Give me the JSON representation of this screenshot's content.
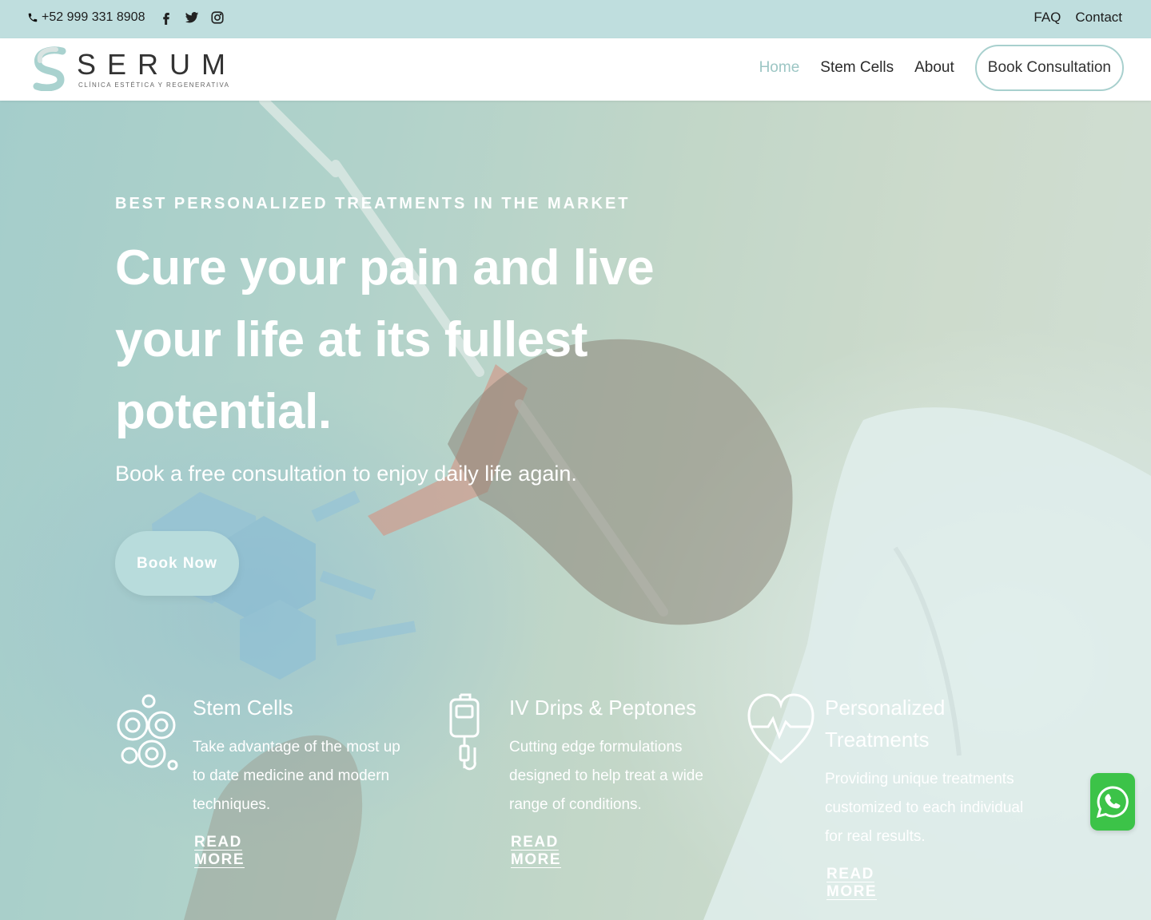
{
  "topbar": {
    "phone": "+52 999 331 8908",
    "socials": [
      "facebook-icon",
      "twitter-icon",
      "instagram-icon"
    ],
    "links": [
      "FAQ",
      "Contact"
    ]
  },
  "header": {
    "logo_word": "SERUM",
    "logo_tagline": "CLÍNICA ESTÉTICA Y REGENERATIVA",
    "nav": {
      "home": "Home",
      "stem_cells": "Stem Cells",
      "about": "About",
      "cta": "Book Consultation"
    }
  },
  "hero": {
    "eyebrow": "BEST PERSONALIZED TREATMENTS IN THE MARKET",
    "headline": "Cure your pain and live your life at its fullest potential.",
    "subline": "Book a free consultation to enjoy daily life again.",
    "button": "Book Now"
  },
  "features": [
    {
      "icon": "cells-icon",
      "title": "Stem Cells",
      "description": "Take advantage of the most up to date medicine and modern techniques.",
      "link": "READ MORE"
    },
    {
      "icon": "iv-drip-icon",
      "title": "IV Drips & Peptones",
      "description": "Cutting edge formulations designed to help treat a wide range of conditions.",
      "link": "READ MORE"
    },
    {
      "icon": "heart-pulse-icon",
      "title": "Personalized Treatments",
      "description": "Providing unique treatments customized to each individual for real results.",
      "link": "READ MORE"
    }
  ],
  "colors": {
    "topbar": "#bfdede",
    "accent": "#9cc6c4",
    "button": "#b8dcdc",
    "whatsapp": "#3cc348"
  }
}
